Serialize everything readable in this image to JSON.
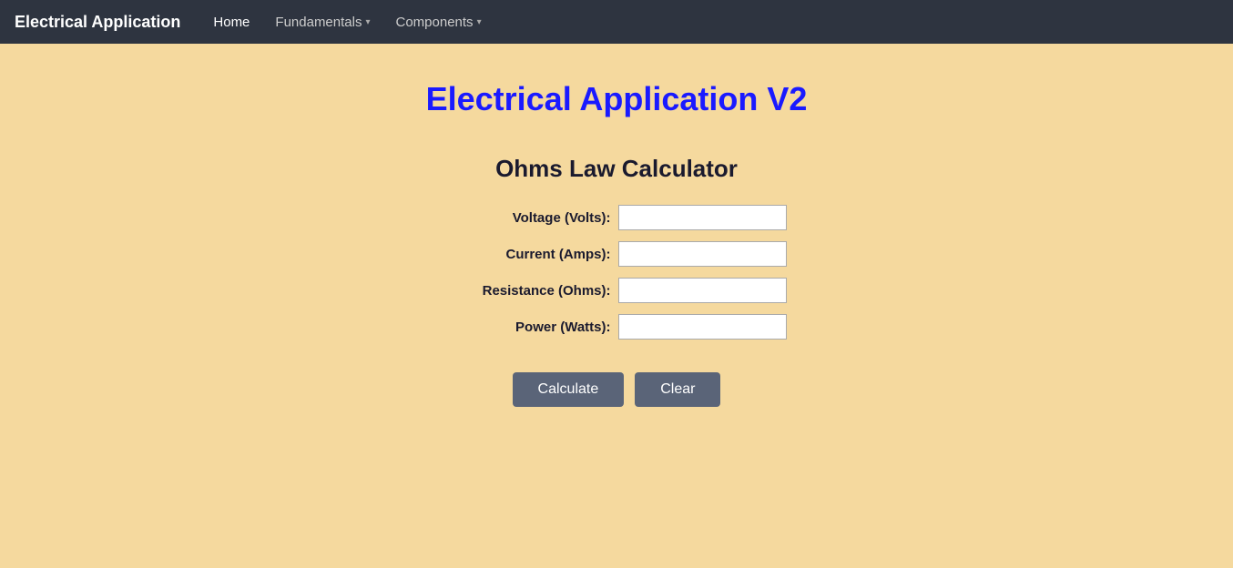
{
  "navbar": {
    "brand": "Electrical Application",
    "links": [
      {
        "label": "Home",
        "active": true,
        "dropdown": false
      },
      {
        "label": "Fundamentals",
        "active": false,
        "dropdown": true
      },
      {
        "label": "Components",
        "active": false,
        "dropdown": true
      }
    ]
  },
  "page": {
    "title": "Electrical Application V2"
  },
  "calculator": {
    "title": "Ohms Law Calculator",
    "fields": [
      {
        "label": "Voltage (Volts):",
        "id": "voltage"
      },
      {
        "label": "Current (Amps):",
        "id": "current"
      },
      {
        "label": "Resistance (Ohms):",
        "id": "resistance"
      },
      {
        "label": "Power (Watts):",
        "id": "power"
      }
    ],
    "buttons": {
      "calculate": "Calculate",
      "clear": "Clear"
    }
  }
}
